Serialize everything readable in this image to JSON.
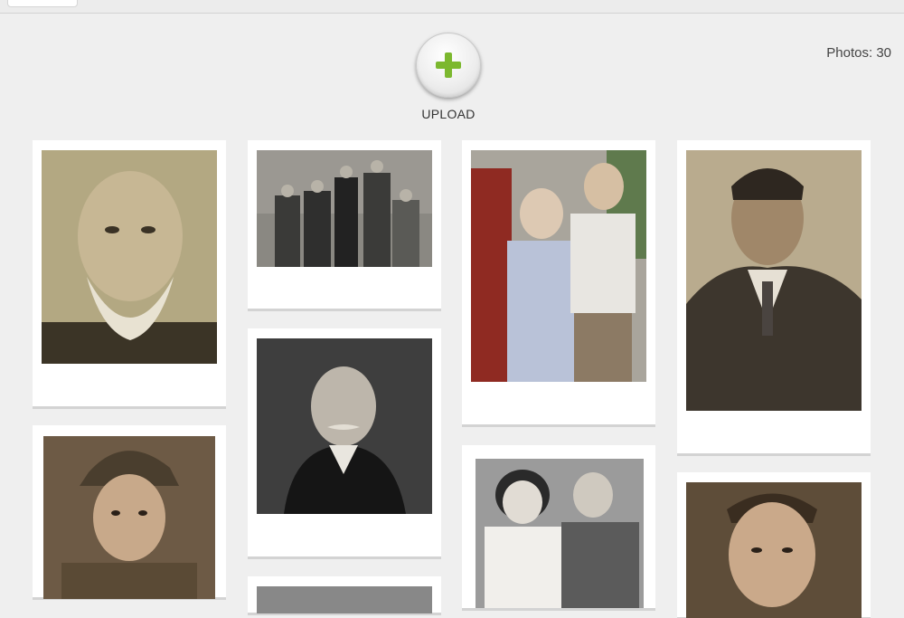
{
  "upload": {
    "label": "UPLOAD",
    "icon": "plus-icon",
    "accent": "#7cb82f"
  },
  "photos_count_text": "Photos: 30",
  "photos": [
    {
      "name": "bearded-elder-portrait",
      "tone": "#a49773"
    },
    {
      "name": "family-group-photo",
      "tone": "#6a6a66"
    },
    {
      "name": "elderly-couple-photo",
      "tone": "#8d8a84"
    },
    {
      "name": "man-in-suit-portrait",
      "tone": "#8f7f66"
    },
    {
      "name": "soldier-portrait",
      "tone": "#5a4a3c"
    },
    {
      "name": "mustached-man-portrait",
      "tone": "#444"
    },
    {
      "name": "couple-photo",
      "tone": "#777"
    },
    {
      "name": "young-man-portrait",
      "tone": "#6b5840"
    },
    {
      "name": "photo-partial",
      "tone": "#888"
    }
  ]
}
